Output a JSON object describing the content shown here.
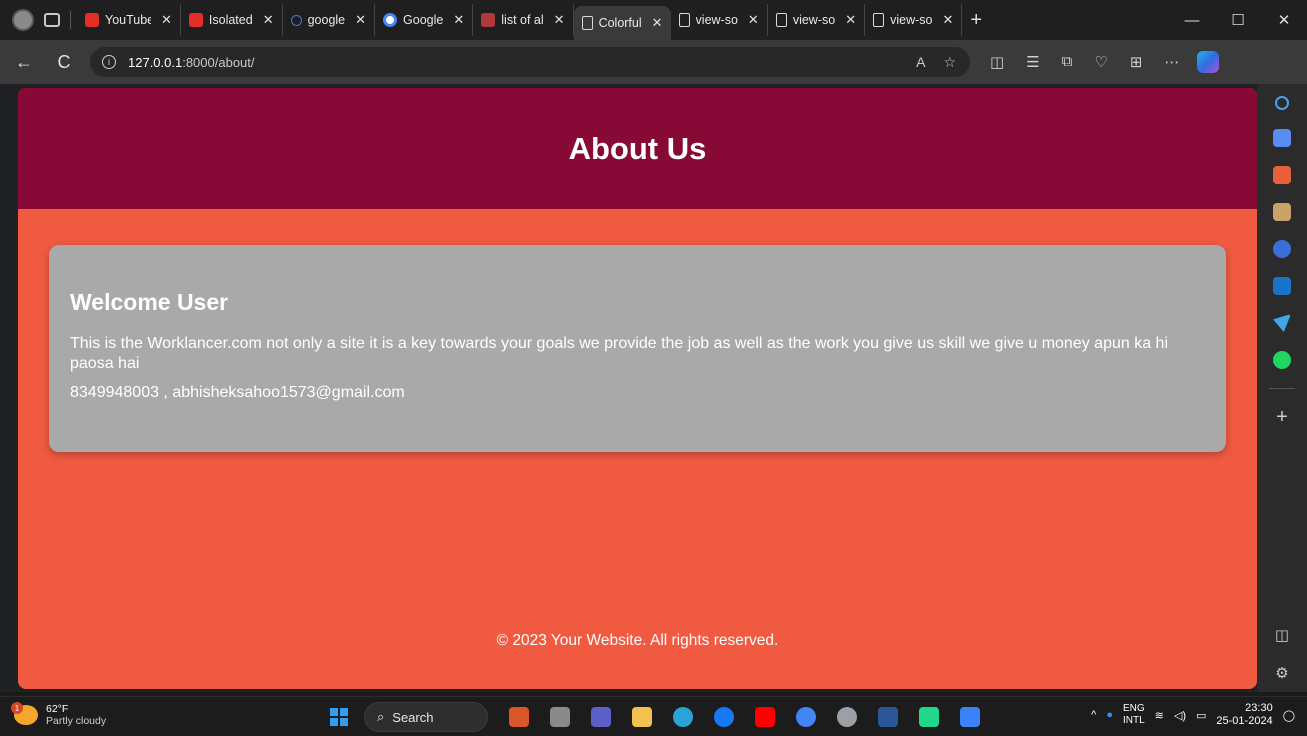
{
  "browser": {
    "tabs": [
      {
        "title": "YouTube",
        "favicon": "youtube-icon",
        "active": false
      },
      {
        "title": "Isolated",
        "favicon": "youtube-icon",
        "active": false
      },
      {
        "title": "google",
        "favicon": "search-icon",
        "active": false
      },
      {
        "title": "Google",
        "favicon": "google-icon",
        "active": false
      },
      {
        "title": "list of al",
        "favicon": "pdf-icon",
        "active": false
      },
      {
        "title": "Colorful",
        "favicon": "document-icon",
        "active": true
      },
      {
        "title": "view-so",
        "favicon": "document-icon",
        "active": false
      },
      {
        "title": "view-so",
        "favicon": "document-icon",
        "active": false
      },
      {
        "title": "view-so",
        "favicon": "document-icon",
        "active": false
      }
    ],
    "new_tab": "+",
    "window_controls": {
      "minimize": "—",
      "maximize": "☐",
      "close": "✕"
    },
    "nav": {
      "back": "←",
      "reload": "C"
    },
    "address": {
      "host": "127.0.0.1",
      "rest": ":8000/about/",
      "info": "i"
    }
  },
  "page": {
    "header_title": "About Us",
    "card": {
      "heading": "Welcome User",
      "body": "This is the Worklancer.com not only a site it is a key towards your goals we provide the job as well as the work you give us skill we give u money apun ka hi paosa hai",
      "contact": "8349948003 , abhisheksahoo1573@gmail.com"
    },
    "footer": "© 2023 Your Website. All rights reserved."
  },
  "colors": {
    "header_bg": "#870a36",
    "page_bg": "#f05a40",
    "card_bg": "#a9a9a9"
  },
  "taskbar": {
    "weather": {
      "temp": "62°F",
      "condition": "Partly cloudy",
      "badge": "1"
    },
    "search_label": "Search",
    "tray": {
      "lang_top": "ENG",
      "lang_bottom": "INTL",
      "time": "23:30",
      "date": "25-01-2024"
    }
  }
}
